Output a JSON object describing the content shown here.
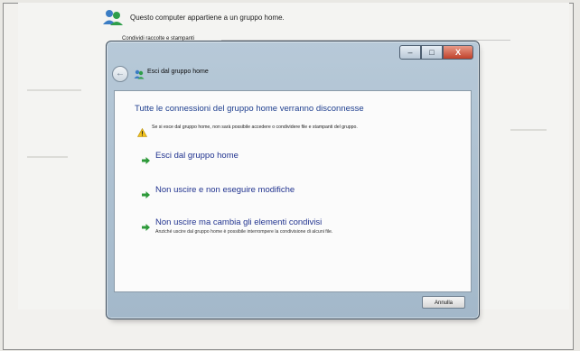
{
  "background": {
    "title": "Questo computer appartiene a un gruppo home.",
    "subtitle": "Condividi raccolte e stampanti"
  },
  "dialog": {
    "title": "Esci dal gruppo home",
    "caption_buttons": {
      "minimize": "–",
      "maximize": "□",
      "close": "X"
    },
    "heading": "Tutte le connessioni del gruppo home verranno disconnesse",
    "warning": "Se si esce dal gruppo home, non sarà possibile accedere o condividere file e stampanti del gruppo.",
    "options": [
      {
        "label": "Esci dal gruppo home",
        "description": ""
      },
      {
        "label": "Non uscire e non eseguire modifiche",
        "description": ""
      },
      {
        "label": "Non uscire ma cambia gli elementi condivisi",
        "description": "Anziché uscire dal gruppo home è possibile interrompere la condivisione di alcuni file."
      }
    ],
    "cancel_label": "Annulla"
  },
  "icons": [
    "homegroup-icon",
    "back-arrow-icon",
    "homegroup-title-icon",
    "warning-icon",
    "green-arrow-icon"
  ]
}
